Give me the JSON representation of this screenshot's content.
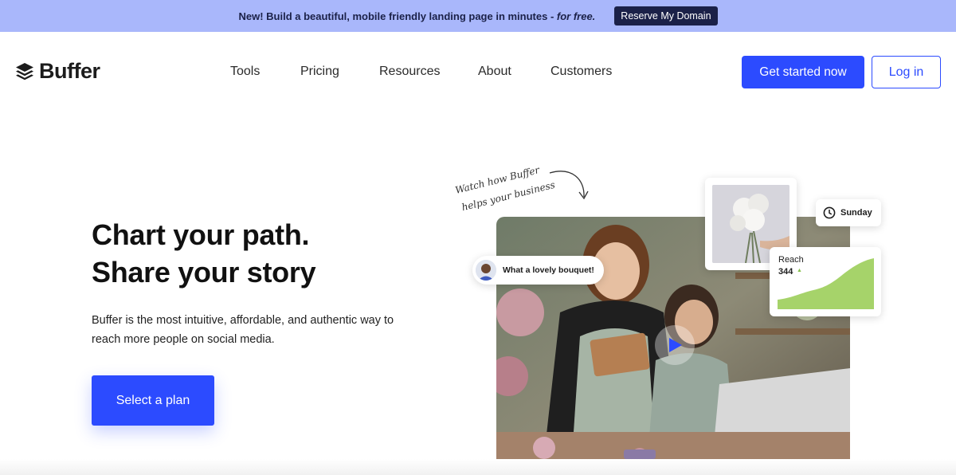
{
  "banner": {
    "text": "New! Build a beautiful, mobile friendly landing page in minutes - ",
    "emphasis": "for free.",
    "button_label": "Reserve My Domain",
    "background": "#a9b7fb"
  },
  "nav": {
    "logo_text": "Buffer",
    "links": [
      "Tools",
      "Pricing",
      "Resources",
      "About",
      "Customers"
    ],
    "primary_button": "Get started now",
    "secondary_button": "Log in"
  },
  "hero": {
    "title_line1": "Chart your path.",
    "title_line2": "Share your story",
    "description": "Buffer is the most intuitive, affordable, and authentic way to reach more people on social media.",
    "cta_label": "Select a plan"
  },
  "visual": {
    "annotation_line1": "Watch how Buffer",
    "annotation_line2": "helps your business",
    "comment": "What a lovely bouquet!",
    "day": "Sunday",
    "reach_label": "Reach",
    "reach_value": "344"
  },
  "colors": {
    "accent": "#2c4bff",
    "banner_text": "#1b2148",
    "chart_fill": "#a6d36a"
  }
}
